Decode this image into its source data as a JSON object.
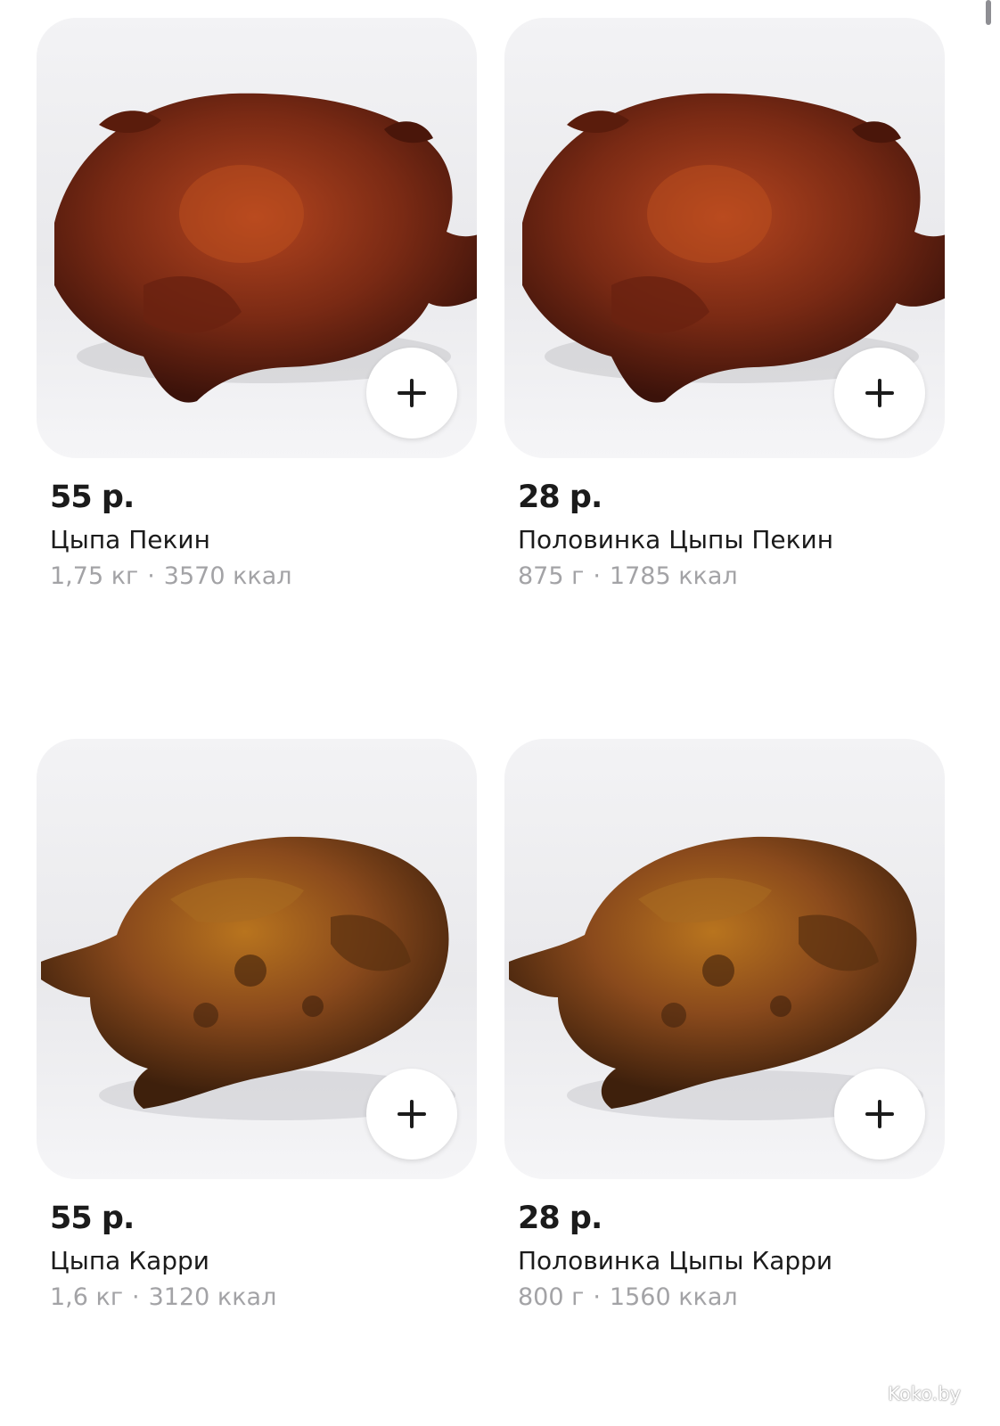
{
  "products": [
    {
      "price": "55 р.",
      "name": "Цыпа Пекин",
      "weight": "1,75 кг",
      "kcal": "3570 ккал",
      "photo": "peking-chicken-photo",
      "add_icon": "plus-icon"
    },
    {
      "price": "28 р.",
      "name": "Половинка Цыпы Пекин",
      "weight": "875 г",
      "kcal": "1785 ккал",
      "photo": "peking-chicken-photo",
      "add_icon": "plus-icon"
    },
    {
      "price": "55 р.",
      "name": "Цыпа Карри",
      "weight": "1,6 кг",
      "kcal": "3120 ккал",
      "photo": "curry-chicken-photo",
      "add_icon": "plus-icon"
    },
    {
      "price": "28 р.",
      "name": "Половинка Цыпы Карри",
      "weight": "800 г",
      "kcal": "1560 ккал",
      "photo": "curry-chicken-photo",
      "add_icon": "plus-icon"
    }
  ],
  "separator": "·",
  "watermark": "Koko.by",
  "colors": {
    "text_primary": "#1b1b1b",
    "text_secondary": "#a3a3a6",
    "card_background": "#f0f0f2",
    "peking_skin": "#7a2a14",
    "curry_skin": "#8a4a1c"
  }
}
